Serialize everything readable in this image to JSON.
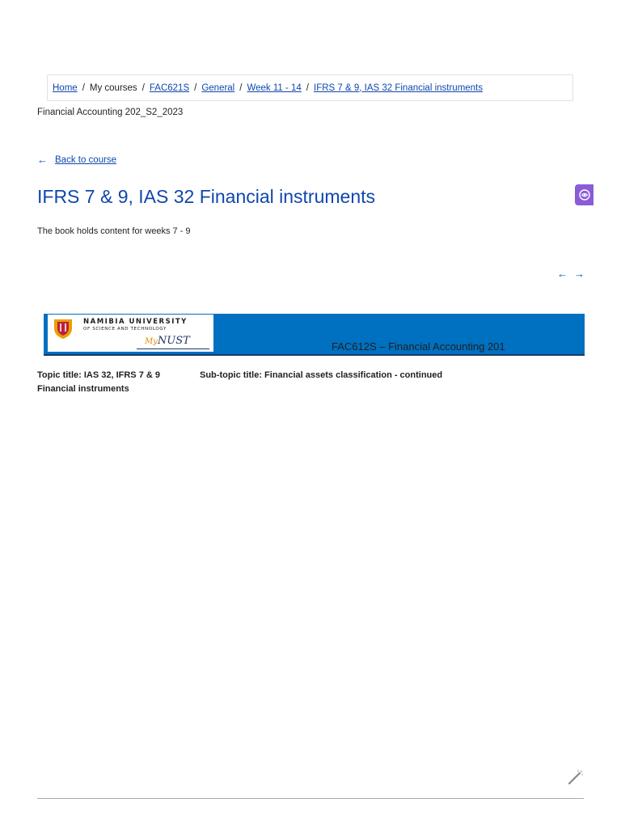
{
  "breadcrumb": {
    "home": "Home",
    "my_courses": "My courses",
    "course_code": "FAC621S",
    "general": "General",
    "week": "Week 11 - 14",
    "current": "IFRS 7 & 9, IAS 32 Financial instruments",
    "separator": "/"
  },
  "course_name": "Financial Accounting 202_S2_2023",
  "back_link": {
    "label": "Back to course",
    "icon": "arrow-left-icon"
  },
  "page": {
    "title": "IFRS 7 & 9, IAS 32 Financial instruments",
    "intro": "The book holds content for weeks 7 - 9"
  },
  "nav": {
    "prev_icon": "←",
    "next_icon": "→"
  },
  "banner": {
    "university_line1": "NAMIBIA UNIVERSITY",
    "university_line2": "OF SCIENCE AND TECHNOLOGY",
    "brand_prefix": "My",
    "brand_suffix": "NUST",
    "title": "FAC612S – Financial Accounting 201",
    "background_color": "#0070c0"
  },
  "content": {
    "topic_title": "Topic title: IAS 32, IFRS 7 & 9 Financial instruments",
    "subtopic_title": "Sub-topic title: Financial assets classification - continued"
  },
  "colors": {
    "link": "#0f47ad",
    "ai_button": "#8a5cd8"
  }
}
